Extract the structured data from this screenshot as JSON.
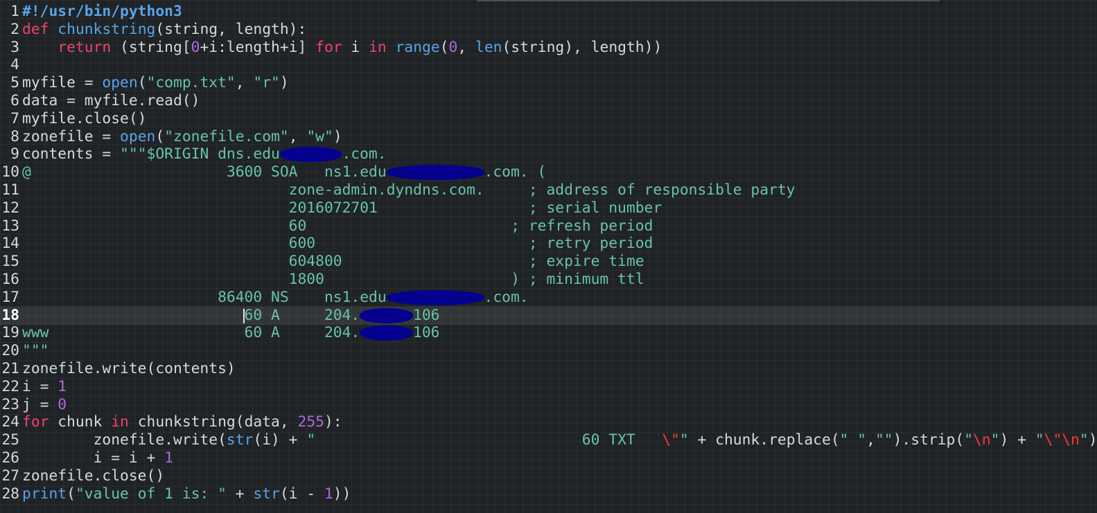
{
  "editor": {
    "cursor_line": 18,
    "colors": {
      "background": "#1f2326",
      "keyword": "#f0426b",
      "builtin": "#5aa3e8",
      "string": "#69c3a8",
      "number": "#b06ad8",
      "escape": "#ff3838",
      "text": "#d7dadc",
      "redaction": "#05008e"
    }
  },
  "lines": [
    {
      "no": "1",
      "tokens": [
        {
          "t": "#!/usr/bin/python3",
          "c": "shebang"
        }
      ]
    },
    {
      "no": "2",
      "tokens": [
        {
          "t": "def",
          "c": "kw"
        },
        {
          "t": " "
        },
        {
          "t": "chunkstring",
          "c": "fn"
        },
        {
          "t": "(string, length):"
        }
      ]
    },
    {
      "no": "3",
      "tokens": [
        {
          "t": "    "
        },
        {
          "t": "return",
          "c": "kw"
        },
        {
          "t": " (string["
        },
        {
          "t": "0",
          "c": "num"
        },
        {
          "t": "+i:length+i] "
        },
        {
          "t": "for",
          "c": "kw"
        },
        {
          "t": " i "
        },
        {
          "t": "in",
          "c": "kw"
        },
        {
          "t": " "
        },
        {
          "t": "range",
          "c": "fn"
        },
        {
          "t": "("
        },
        {
          "t": "0",
          "c": "num"
        },
        {
          "t": ", "
        },
        {
          "t": "len",
          "c": "fn"
        },
        {
          "t": "(string), length))"
        }
      ]
    },
    {
      "no": "4",
      "tokens": []
    },
    {
      "no": "5",
      "tokens": [
        {
          "t": "myfile = "
        },
        {
          "t": "open",
          "c": "fn"
        },
        {
          "t": "("
        },
        {
          "t": "\"comp.txt\"",
          "c": "str"
        },
        {
          "t": ", "
        },
        {
          "t": "\"r\"",
          "c": "str"
        },
        {
          "t": ")"
        }
      ]
    },
    {
      "no": "6",
      "tokens": [
        {
          "t": "data = myfile.read()"
        }
      ]
    },
    {
      "no": "7",
      "tokens": [
        {
          "t": "myfile.close()"
        }
      ]
    },
    {
      "no": "8",
      "tokens": [
        {
          "t": "zonefile = "
        },
        {
          "t": "open",
          "c": "fn"
        },
        {
          "t": "("
        },
        {
          "t": "\"zonefile.com\"",
          "c": "str"
        },
        {
          "t": ", "
        },
        {
          "t": "\"w\"",
          "c": "str"
        },
        {
          "t": ")"
        }
      ]
    },
    {
      "no": "9",
      "tokens": [
        {
          "t": "contents = "
        },
        {
          "t": "\"\"\"$ORIGIN dns.edu",
          "c": "str"
        },
        {
          "redact": 7
        },
        {
          "t": ".com.",
          "c": "str"
        }
      ]
    },
    {
      "no": "10",
      "tokens": [
        {
          "t": "@                      3600 SOA   ns1.edu",
          "c": "str"
        },
        {
          "redact": 11
        },
        {
          "t": ".com. (",
          "c": "str"
        }
      ]
    },
    {
      "no": "11",
      "tokens": [
        {
          "t": "                              zone-admin.dyndns.com.     ; address of responsible party",
          "c": "str"
        }
      ]
    },
    {
      "no": "12",
      "tokens": [
        {
          "t": "                              2016072701                 ; serial number",
          "c": "str"
        }
      ]
    },
    {
      "no": "13",
      "tokens": [
        {
          "t": "                              60                       ; refresh period",
          "c": "str"
        }
      ]
    },
    {
      "no": "14",
      "tokens": [
        {
          "t": "                              600                        ; retry period",
          "c": "str"
        }
      ]
    },
    {
      "no": "15",
      "tokens": [
        {
          "t": "                              604800                     ; expire time",
          "c": "str"
        }
      ]
    },
    {
      "no": "16",
      "tokens": [
        {
          "t": "                              1800                     ) ; minimum ttl",
          "c": "str"
        }
      ]
    },
    {
      "no": "17",
      "tokens": [
        {
          "t": "                      86400 NS    ns1.edu",
          "c": "str"
        },
        {
          "redact": 11
        },
        {
          "t": ".com.",
          "c": "str"
        }
      ]
    },
    {
      "no": "18",
      "tokens": [
        {
          "t": "                         60 A     204.",
          "c": "str"
        },
        {
          "redact": 6
        },
        {
          "t": "106",
          "c": "str"
        }
      ]
    },
    {
      "no": "19",
      "tokens": [
        {
          "t": "www                      60 A     204.",
          "c": "str"
        },
        {
          "redact": 6
        },
        {
          "t": "106",
          "c": "str"
        }
      ]
    },
    {
      "no": "20",
      "tokens": [
        {
          "t": "\"\"\"",
          "c": "str"
        }
      ]
    },
    {
      "no": "21",
      "tokens": [
        {
          "t": "zonefile.write(contents)"
        }
      ]
    },
    {
      "no": "22",
      "tokens": [
        {
          "t": "i = "
        },
        {
          "t": "1",
          "c": "num"
        }
      ]
    },
    {
      "no": "23",
      "tokens": [
        {
          "t": "j = "
        },
        {
          "t": "0",
          "c": "num"
        }
      ]
    },
    {
      "no": "24",
      "tokens": [
        {
          "t": "for",
          "c": "kw"
        },
        {
          "t": " chunk "
        },
        {
          "t": "in",
          "c": "kw"
        },
        {
          "t": " chunkstring(data, "
        },
        {
          "t": "255",
          "c": "num"
        },
        {
          "t": "):"
        }
      ]
    },
    {
      "no": "25",
      "tokens": [
        {
          "t": "        zonefile.write("
        },
        {
          "t": "str",
          "c": "fn"
        },
        {
          "t": "(i) + "
        },
        {
          "t": "\"                              60 TXT   ",
          "c": "str"
        },
        {
          "t": "\\\"",
          "c": "esc"
        },
        {
          "t": "\"",
          "c": "str"
        },
        {
          "t": " + chunk.replace("
        },
        {
          "t": "\" \"",
          "c": "str"
        },
        {
          "t": ","
        },
        {
          "t": "\"\"",
          "c": "str"
        },
        {
          "t": ").strip("
        },
        {
          "t": "\"",
          "c": "str"
        },
        {
          "t": "\\n",
          "c": "esc"
        },
        {
          "t": "\"",
          "c": "str"
        },
        {
          "t": ") + "
        },
        {
          "t": "\"",
          "c": "str"
        },
        {
          "t": "\\\"\\n",
          "c": "esc"
        },
        {
          "t": "\"",
          "c": "str"
        },
        {
          "t": ")"
        }
      ]
    },
    {
      "no": "26",
      "tokens": [
        {
          "t": "        i = i + "
        },
        {
          "t": "1",
          "c": "num"
        }
      ]
    },
    {
      "no": "27",
      "tokens": [
        {
          "t": "zonefile.close()"
        }
      ]
    },
    {
      "no": "28",
      "tokens": [
        {
          "t": "print",
          "c": "fn"
        },
        {
          "t": "("
        },
        {
          "t": "\"value of 1 is: \"",
          "c": "str"
        },
        {
          "t": " + "
        },
        {
          "t": "str",
          "c": "fn"
        },
        {
          "t": "(i - "
        },
        {
          "t": "1",
          "c": "num"
        },
        {
          "t": "))"
        }
      ]
    }
  ]
}
